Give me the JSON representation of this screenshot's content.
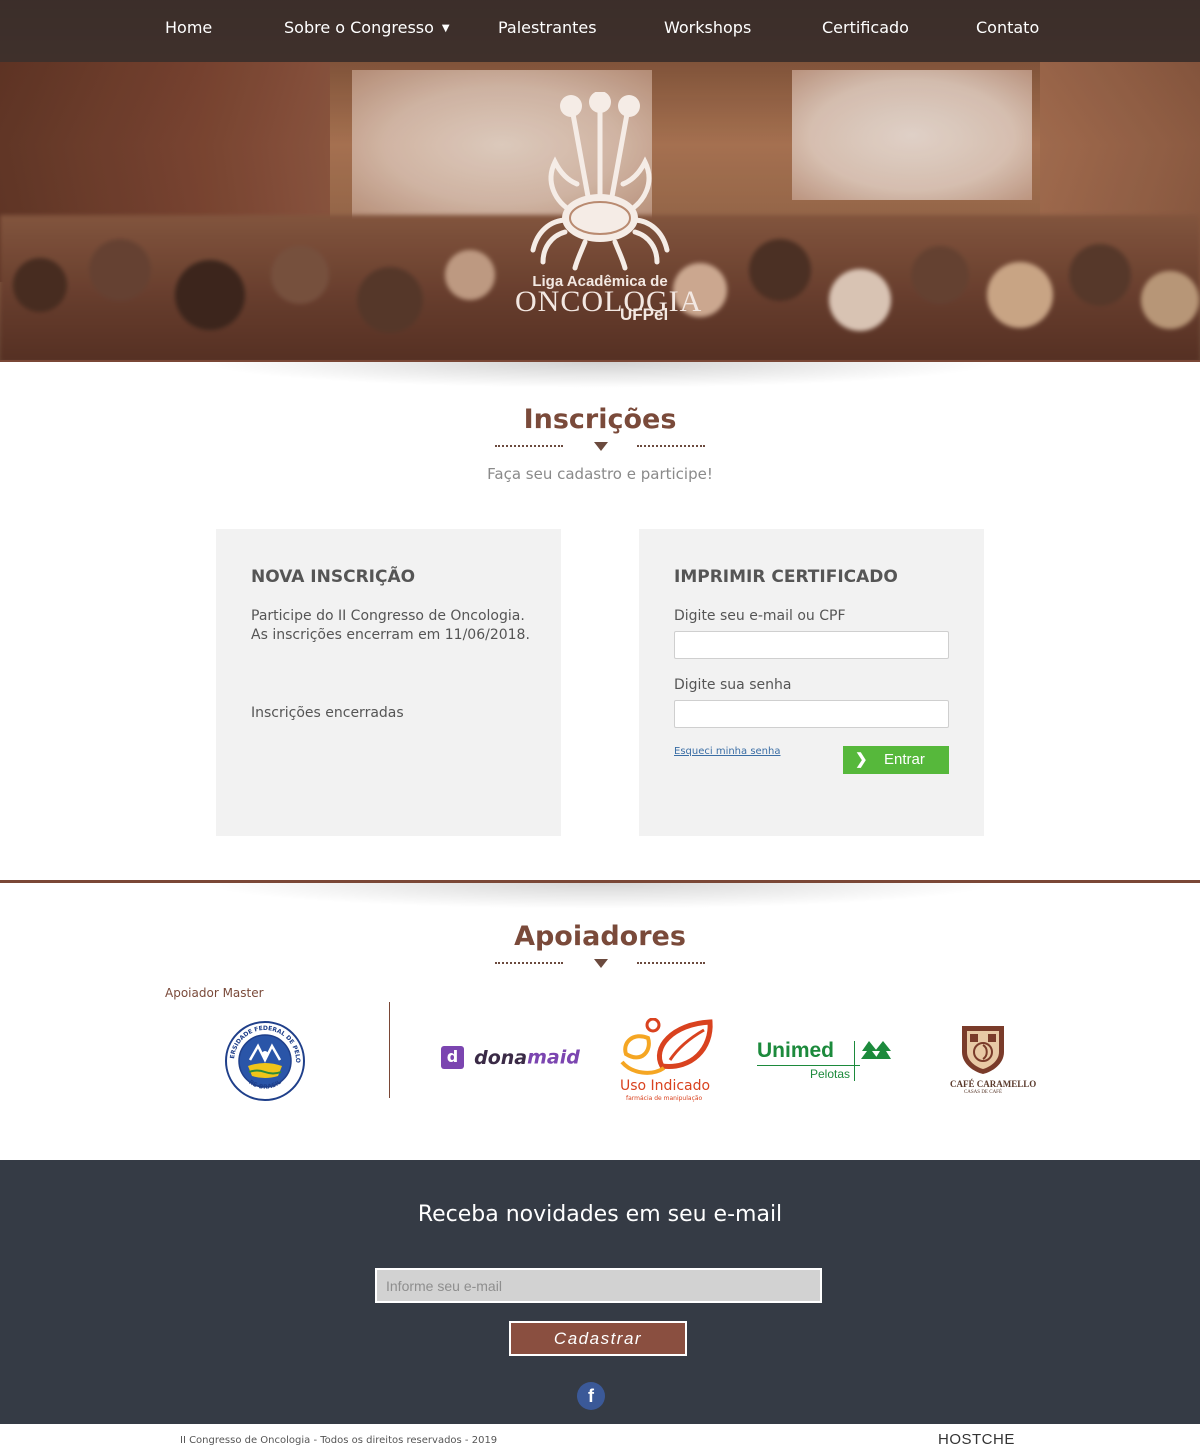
{
  "nav": {
    "items": [
      {
        "label": "Home"
      },
      {
        "label": "Sobre o Congresso",
        "has_dropdown": true
      },
      {
        "label": "Palestrantes"
      },
      {
        "label": "Workshops"
      },
      {
        "label": "Certificado"
      },
      {
        "label": "Contato"
      }
    ],
    "dropdown_caret": "▼"
  },
  "hero": {
    "logo": {
      "line1": "Liga Acadêmica de",
      "line2": "ONCOLOGIA",
      "line3": "UFPel"
    }
  },
  "inscricoes": {
    "title": "Inscrições",
    "subtitle": "Faça seu cadastro e participe!",
    "nova": {
      "title": "NOVA INSCRIÇÃO",
      "text1": "Participe do II Congresso de Oncologia.",
      "text2": "As inscrições encerram em 11/06/2018.",
      "status": "Inscrições encerradas"
    },
    "certificado": {
      "title": "IMPRIMIR CERTIFICADO",
      "email_label": "Digite seu e-mail ou CPF",
      "email_value": "",
      "password_label": "Digite sua senha",
      "password_value": "",
      "forgot_label": "Esqueci minha senha",
      "submit_label": "Entrar"
    }
  },
  "apoiadores": {
    "title": "Apoiadores",
    "master_label": "Apoiador Master",
    "master": {
      "name": "Universidade Federal de Pelotas",
      "ring_top": "UNIVERSIDADE FEDERAL DE PELOTAS",
      "ring_bottom": "RS·BRASIL"
    },
    "sponsors": [
      {
        "name": "donamaid",
        "part1": "dona",
        "part2": "maid",
        "badge": "d",
        "color": "#7b45b0"
      },
      {
        "name": "Uso Indicado",
        "tagline": "farmácia de manipulação",
        "color": "#d9421f"
      },
      {
        "name": "Unimed",
        "sub": "Pelotas",
        "color": "#1c8a3c"
      },
      {
        "name": "CAFÉ CARAMELLO",
        "tagline": "CASAS DE CAFÉ",
        "color": "#7a3b2a"
      }
    ]
  },
  "footer": {
    "newsletter_title": "Receba novidades em seu e-mail",
    "email_placeholder": "Informe seu e-mail",
    "submit_label": "Cadastrar",
    "social": [
      {
        "icon": "facebook-icon",
        "glyph": "f"
      }
    ],
    "copyright": "II Congresso de Oncologia - Todos os direitos reservados - 2019",
    "credit": "HOSTCHE"
  },
  "colors": {
    "accent_brown": "#7a4a3a",
    "button_green": "#56b83b",
    "footer_bg": "#353b45",
    "card_bg": "#f2f2f2"
  }
}
